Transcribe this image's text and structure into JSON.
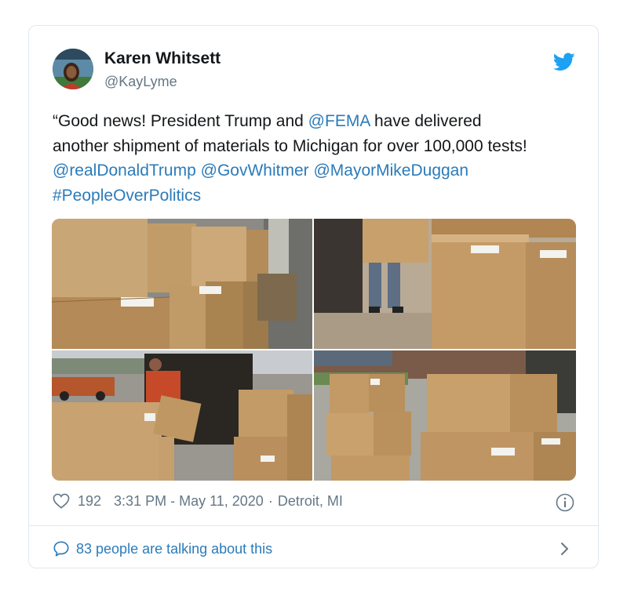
{
  "tweet": {
    "author_name": "Karen Whitsett",
    "author_handle": "@KayLyme",
    "text_lines": [
      [
        {
          "t": "“Good news!  President Trump and ",
          "link": false
        },
        {
          "t": "@FEMA",
          "link": true
        },
        {
          "t": " have delivered",
          "link": false
        }
      ],
      [
        {
          "t": "another shipment of materials to Michigan for over 100,000 tests!",
          "link": false
        }
      ],
      [
        {
          "t": "@realDonaldTrump",
          "link": true
        },
        {
          "t": " ",
          "link": false
        },
        {
          "t": "@GovWhitmer",
          "link": true
        },
        {
          "t": " ",
          "link": false
        },
        {
          "t": "@MayorMikeDuggan",
          "link": true
        }
      ],
      [
        {
          "t": "#PeopleOverPolitics",
          "link": true
        }
      ]
    ],
    "like_count": "192",
    "time": "3:31 PM - May 11, 2020",
    "location": "Detroit, MI",
    "talking": "83 people are talking about this"
  },
  "colors": {
    "link": "#2b7bb9",
    "secondary": "#657786",
    "twitter_blue": "#1da1f2",
    "border": "#e1e8ed"
  },
  "icons": [
    "twitter-bird-icon",
    "heart-icon",
    "info-icon",
    "speech-bubble-icon",
    "chevron-right-icon"
  ]
}
